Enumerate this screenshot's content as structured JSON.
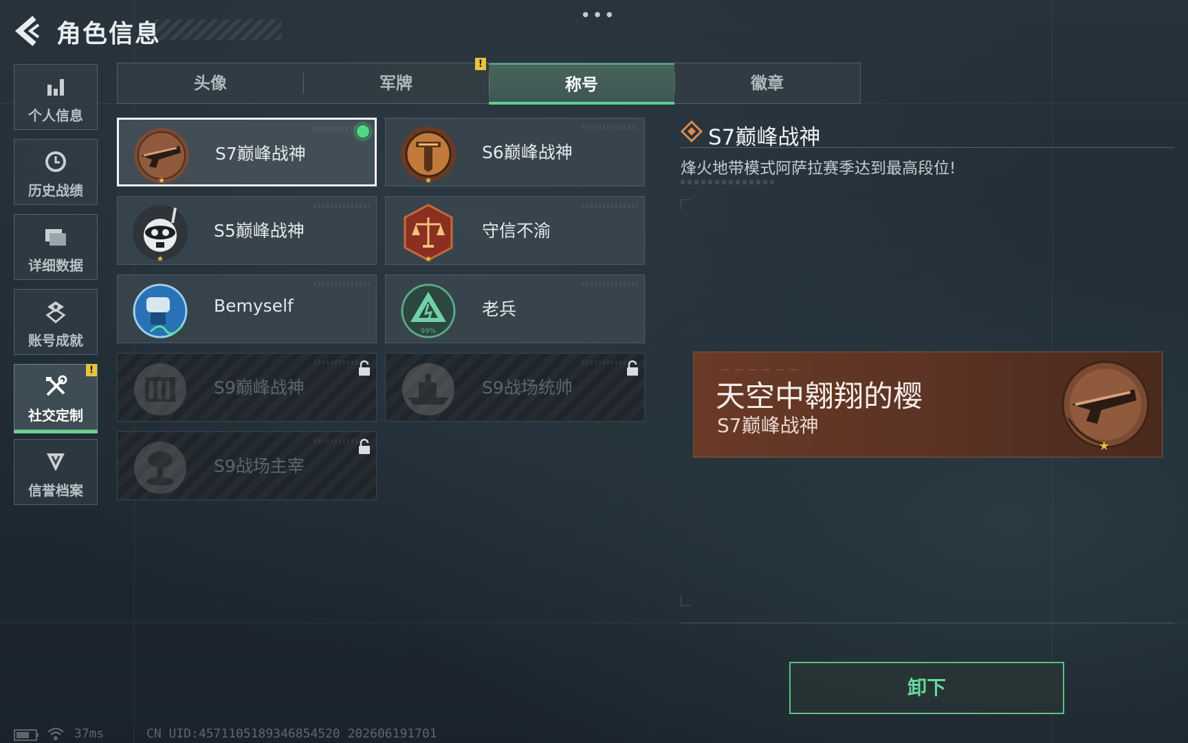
{
  "header": {
    "title": "角色信息",
    "more": "•••"
  },
  "sidebar": {
    "items": [
      {
        "label": "个人信息",
        "icon": "bar-chart-icon"
      },
      {
        "label": "历史战绩",
        "icon": "history-clock-icon"
      },
      {
        "label": "详细数据",
        "icon": "folder-icon"
      },
      {
        "label": "账号成就",
        "icon": "achievement-icon"
      },
      {
        "label": "社交定制",
        "icon": "tools-icon",
        "active": true,
        "badge": "!"
      },
      {
        "label": "信誉档案",
        "icon": "shield-icon"
      }
    ]
  },
  "tabs": {
    "items": [
      "头像",
      "军牌",
      "称号",
      "徽章"
    ],
    "active": "称号",
    "badge": "!"
  },
  "titles": [
    {
      "name": "S7巅峰战神",
      "selected": true,
      "equipped": true,
      "locked": false
    },
    {
      "name": "S6巅峰战神",
      "locked": false
    },
    {
      "name": "S5巅峰战神",
      "locked": false
    },
    {
      "name": "守信不渝",
      "locked": false
    },
    {
      "name": "Bemyself",
      "locked": false
    },
    {
      "name": "老兵",
      "locked": false,
      "medal_text": "99%"
    },
    {
      "name": "S9巅峰战神",
      "locked": true
    },
    {
      "name": "S9战场统帅",
      "locked": true
    },
    {
      "name": "S9战场主宰",
      "locked": true
    }
  ],
  "detail": {
    "title": "S7巅峰战神",
    "description": "烽火地带模式阿萨拉赛季达到最高段位!"
  },
  "preview": {
    "player_name": "天空中翱翔的樱",
    "title": "S7巅峰战神"
  },
  "actions": {
    "unequip_label": "卸下"
  },
  "status": {
    "ping": "37ms",
    "uid": "CN UID:4571105189346854520 202606191701"
  },
  "colors": {
    "accent": "#61cf8d",
    "badge": "#e9c33e",
    "preview_bg": "#5a3223"
  }
}
